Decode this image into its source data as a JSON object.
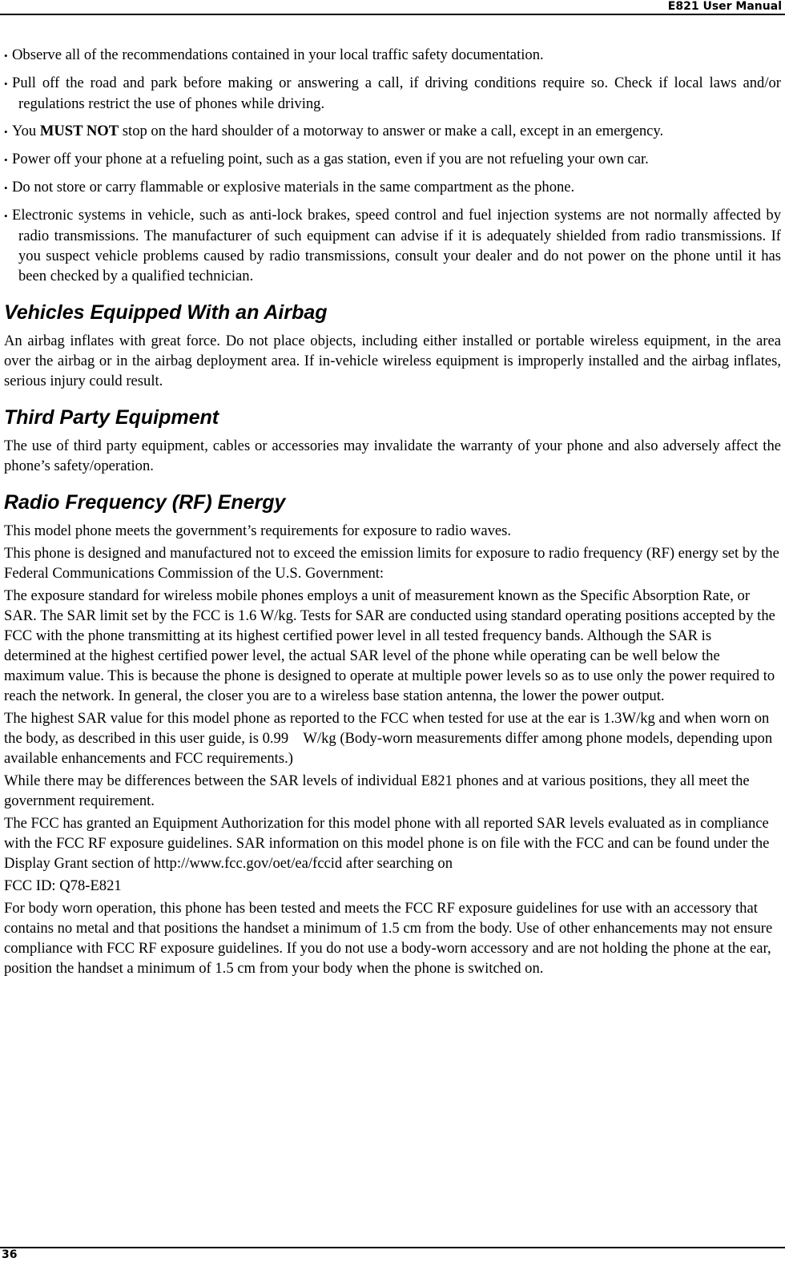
{
  "header": {
    "title": "E821 User Manual"
  },
  "footer": {
    "page_number": "36"
  },
  "bullets": [
    {
      "text": "Observe all of the recommendations contained in your local traffic safety documentation."
    },
    {
      "text": "Pull off the road and park before making or answering a call, if driving conditions require so. Check if local laws and/or regulations restrict the use of phones while driving."
    },
    {
      "pre": "You ",
      "bold": "MUST NOT",
      "post": " stop on the hard shoulder of a motorway to answer or make a call, except in an emergency."
    },
    {
      "text": "Power off your phone at a refueling point, such as a gas station, even if you are not refueling your own car."
    },
    {
      "text": "Do not store or carry flammable or explosive materials in the same compartment as the phone."
    },
    {
      "text": "Electronic systems in vehicle, such as anti-lock brakes, speed control and fuel injection systems are not normally affected by radio transmissions. The manufacturer of such equipment can advise if it is adequately shielded from radio transmissions. If you suspect vehicle problems caused by radio transmissions, consult your dealer and do not power on the phone until it has been checked by a qualified technician."
    }
  ],
  "bullet_glyph": "•",
  "sections": {
    "airbag": {
      "heading": "Vehicles Equipped With an Airbag",
      "paragraph": "An airbag inflates with great force. Do not place objects, including either installed or portable wireless equipment, in the area over the airbag or in the airbag deployment area. If in-vehicle wireless equipment is improperly installed and the airbag inflates, serious injury could result."
    },
    "third_party": {
      "heading": "Third Party Equipment",
      "paragraph": "The use of third party equipment, cables or accessories may invalidate the warranty of your phone and also adversely affect the phone’s safety/operation."
    },
    "rf": {
      "heading": "Radio Frequency (RF) Energy",
      "paragraphs": [
        "This model phone meets the government’s requirements for exposure to radio waves.",
        "This phone is designed and manufactured not to exceed the emission limits for exposure to radio frequency (RF) energy set by the Federal Communications Commission of the U.S. Government:",
        "The exposure standard for wireless mobile phones employs a unit of measurement known as the Specific Absorption Rate, or SAR. The SAR limit set by the FCC is 1.6 W/kg. Tests for SAR are conducted using standard operating positions accepted by the FCC with the phone transmitting at its highest certified power level in all tested frequency bands. Although the SAR is determined at the highest certified power level, the actual SAR level of the phone while operating can be well below the maximum value. This is because the phone is designed to operate at multiple power levels so as to use only the power required to reach the network. In general, the closer you are to a wireless base station antenna, the lower the power output.",
        "The highest SAR value for this model phone as reported to the FCC when tested for use at the ear is 1.3W/kg and when worn on the body, as described in this user guide, is 0.99    W/kg (Body-worn measurements differ among phone models, depending upon available enhancements and FCC requirements.)",
        "While there may be differences between the SAR levels of individual E821 phones and at various positions, they all meet the government requirement.",
        "The FCC has granted an Equipment Authorization for this model phone with all reported SAR levels evaluated as in compliance with the FCC RF exposure guidelines. SAR information on this model phone is on file with the FCC and can be found under the Display Grant section of http://www.fcc.gov/oet/ea/fccid after searching on",
        "FCC ID: Q78-E821",
        "For body worn operation, this phone has been tested and meets the FCC RF exposure guidelines for use with an accessory that contains no metal and that positions the handset a minimum of 1.5 cm from the body. Use of other enhancements may not ensure compliance with FCC RF exposure guidelines. If you do not use a body-worn accessory and are not holding the phone at the ear, position the handset a minimum of 1.5 cm from your body when the phone is switched on."
      ]
    }
  }
}
